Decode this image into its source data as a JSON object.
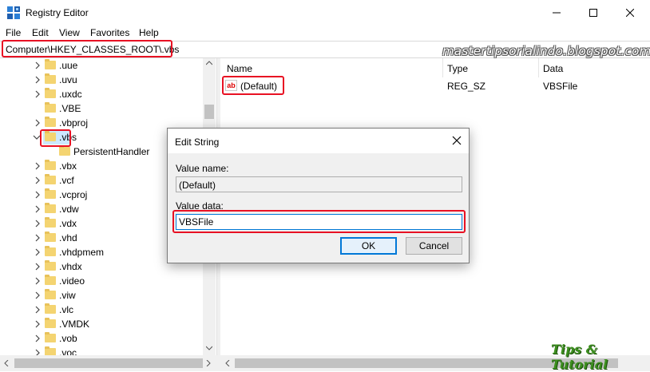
{
  "window": {
    "title": "Registry Editor"
  },
  "menu": [
    "File",
    "Edit",
    "View",
    "Favorites",
    "Help"
  ],
  "address": {
    "path": "Computer\\HKEY_CLASSES_ROOT\\.vbs"
  },
  "tree": {
    "items": [
      {
        "label": ".uue",
        "expandable": true
      },
      {
        "label": ".uvu",
        "expandable": true
      },
      {
        "label": ".uxdc",
        "expandable": true
      },
      {
        "label": ".VBE",
        "expandable": false
      },
      {
        "label": ".vbproj",
        "expandable": true
      },
      {
        "label": ".vbs",
        "expandable": true,
        "expanded": true,
        "selected": true
      },
      {
        "label": "PersistentHandler",
        "expandable": false,
        "child": true
      },
      {
        "label": ".vbx",
        "expandable": true
      },
      {
        "label": ".vcf",
        "expandable": true
      },
      {
        "label": ".vcproj",
        "expandable": true
      },
      {
        "label": ".vdw",
        "expandable": true
      },
      {
        "label": ".vdx",
        "expandable": true
      },
      {
        "label": ".vhd",
        "expandable": true
      },
      {
        "label": ".vhdpmem",
        "expandable": true
      },
      {
        "label": ".vhdx",
        "expandable": true
      },
      {
        "label": ".video",
        "expandable": true
      },
      {
        "label": ".viw",
        "expandable": true
      },
      {
        "label": ".vlc",
        "expandable": true
      },
      {
        "label": ".VMDK",
        "expandable": true
      },
      {
        "label": ".vob",
        "expandable": true
      },
      {
        "label": ".voc",
        "expandable": true
      }
    ]
  },
  "list": {
    "headers": {
      "name": "Name",
      "type": "Type",
      "data": "Data"
    },
    "rows": [
      {
        "name": "(Default)",
        "type": "REG_SZ",
        "data": "VBSFile"
      }
    ]
  },
  "dialog": {
    "title": "Edit String",
    "value_name_label": "Value name:",
    "value_name": "(Default)",
    "value_data_label": "Value data:",
    "value_data": "VBSFile",
    "ok_label": "OK",
    "cancel_label": "Cancel"
  },
  "watermark": {
    "site": "mastertipsorialindo.blogspot.com",
    "logo": "Tips & Tutorial"
  },
  "colors": {
    "highlight": "#e81123",
    "accent": "#0078d7",
    "folder": "#f4d471",
    "selection": "#cce8ff"
  },
  "icons": [
    "registry-editor-icon",
    "minimize-icon",
    "maximize-icon",
    "close-icon",
    "chevron-right-icon",
    "chevron-down-icon",
    "folder-icon",
    "string-value-icon"
  ]
}
